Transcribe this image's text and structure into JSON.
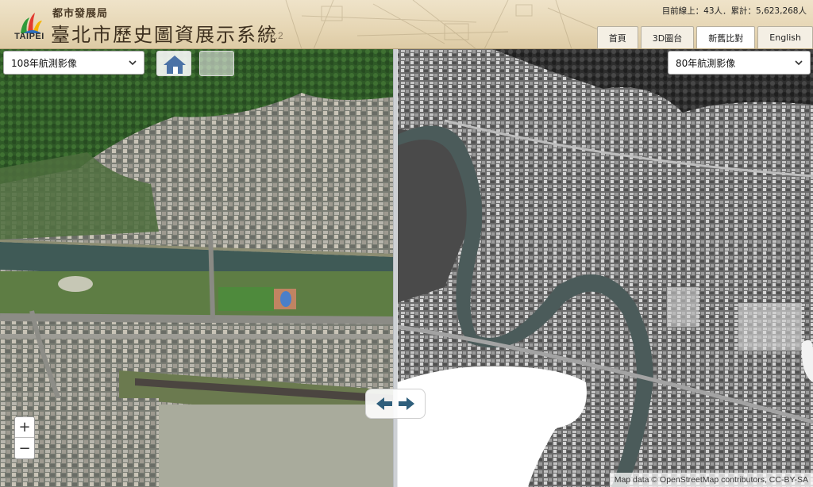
{
  "header": {
    "logo_text": "TAIPEI",
    "department": "都市發展局",
    "title": "臺北市歷史圖資展示系統",
    "version": "v2.2",
    "counter": "目前線上：43人．累計：5,623,268人"
  },
  "nav": {
    "tabs": [
      {
        "label": "首頁",
        "active": false
      },
      {
        "label": "3D圖台",
        "active": false
      },
      {
        "label": "新舊比對",
        "active": true
      },
      {
        "label": "English",
        "active": false
      }
    ]
  },
  "map": {
    "left_layer": {
      "selected": "108年航測影像"
    },
    "right_layer": {
      "selected": "80年航測影像"
    },
    "zoom_in_label": "+",
    "zoom_out_label": "−",
    "attribution": "Map data © OpenStreetMap contributors, CC-BY-SA"
  },
  "icons": {
    "home": "home-icon",
    "swipe": "arrows-left-right-icon",
    "select": "chevron-down-icon"
  },
  "colors": {
    "header_bg": "#e6d6b4",
    "swipe_arrow": "#2f5f7c",
    "home_icon": "#4b72a6",
    "river_color": "#4b5b5a"
  }
}
